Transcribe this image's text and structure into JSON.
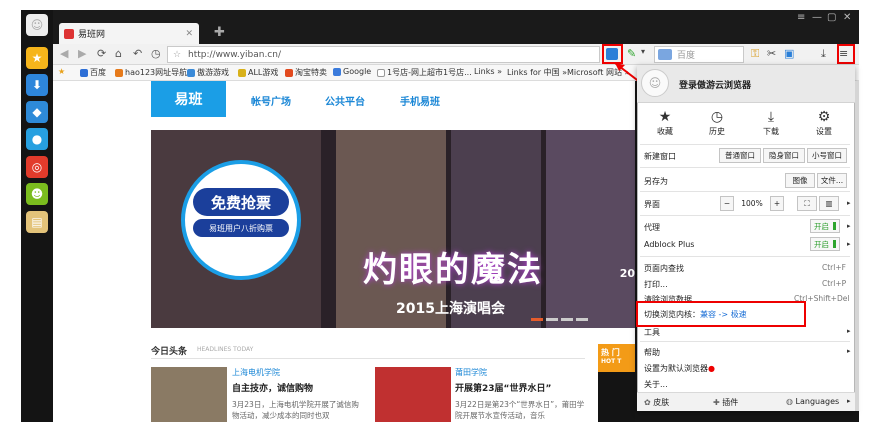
{
  "tab": {
    "title": "易班网"
  },
  "address": {
    "url": "http://www.yiban.cn/"
  },
  "search": {
    "placeholder": "百度"
  },
  "bookmarks": [
    {
      "label": "百度",
      "color": "#2e6fd6"
    },
    {
      "label": "hao123网址导航",
      "color": "#e67a1a"
    },
    {
      "label": "傲游游戏",
      "color": "#3a8ad8"
    },
    {
      "label": "ALL游戏",
      "color": "#d8b11a"
    },
    {
      "label": "淘宝特卖",
      "color": "#e24a1e"
    },
    {
      "label": "Google",
      "color": "#3b7bdc"
    },
    {
      "label": "1号店-网上超市1号店...",
      "color": "#ffffff"
    },
    {
      "label": "Links »",
      "color": ""
    },
    {
      "label": "Links for 中国 »",
      "color": ""
    },
    {
      "label": "Microsoft 网站 »",
      "color": ""
    }
  ],
  "site": {
    "logo": "易班",
    "nav": [
      "帐号广场",
      "公共平台",
      "手机易班"
    ],
    "hero": {
      "badge1": "免费抢票",
      "badge2": "易班用户八折购票",
      "title": "灼眼的魔法",
      "subtitle": "2015上海演唱会",
      "year": "20"
    },
    "headlines": {
      "title": "今日头条",
      "subtitle": "HEADLINES TODAY",
      "items": [
        {
          "school": "上海电机学院",
          "headline": "自主技亦，诚信购物",
          "desc": "3月23日，上海电机学院开展了诚信购物活动，减少成本的同时也双"
        },
        {
          "school": "莆田学院",
          "headline": "开展第23届“世界水日”",
          "desc": "3月22日是第23个“世界水日”，莆田学院开展节水宣传活动，音乐"
        }
      ]
    },
    "hot": {
      "label": "热 门",
      "sub": "HOT T"
    }
  },
  "menu": {
    "login": "登录傲游云浏览器",
    "quick": [
      {
        "label": "收藏",
        "icon": "★"
      },
      {
        "label": "历史",
        "icon": "◷"
      },
      {
        "label": "下载",
        "icon": "⤓"
      },
      {
        "label": "设置",
        "icon": "⚙"
      }
    ],
    "new_window": "新建窗口",
    "window_types": [
      "普通窗口",
      "隐身窗口",
      "小号窗口"
    ],
    "save_as": "另存为",
    "save_btns": [
      "图像",
      "文件..."
    ],
    "ui": "界面",
    "zoom": {
      "minus": "−",
      "value": "100%",
      "plus": "+"
    },
    "proxy": "代理",
    "proxy_state": "开启",
    "adblock": "Adblock Plus",
    "adblock_state": "开启",
    "find": "页面内查找",
    "find_key": "Ctrl+F",
    "print": "打印...",
    "print_key": "Ctrl+P",
    "clear": "清除浏览数据",
    "clear_key": "Ctrl+Shift+Del",
    "core_prefix": "切换浏览内核：",
    "core_a": "兼容",
    "core_arrow": " -> ",
    "core_b": "极速",
    "tools": "工具",
    "help": "帮助",
    "default": "设置为默认浏览器",
    "about": "关于...",
    "skin": "皮肤",
    "plugin": "插件",
    "lang": "Languages"
  }
}
